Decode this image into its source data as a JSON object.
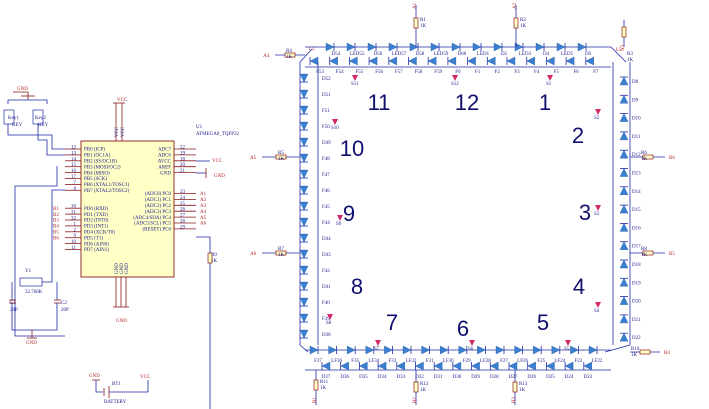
{
  "mcu": {
    "ref": "U1",
    "part": "ATMEGA8_TQFP32",
    "left_pins": [
      {
        "num": "12",
        "name": "PB0 (ICP)"
      },
      {
        "num": "13",
        "name": "PB1 (OC1A)"
      },
      {
        "num": "14",
        "name": "PB2 (SS/OC1B)"
      },
      {
        "num": "15",
        "name": "PB3 (MOSI/OC2)"
      },
      {
        "num": "16",
        "name": "PB4 (MISO)"
      },
      {
        "num": "17",
        "name": "PB5 (SCK)"
      },
      {
        "num": "7",
        "name": "PB6 (XTAL1/TOSC1)"
      },
      {
        "num": "8",
        "name": "PB7 (XTAL2/TOSC2)"
      },
      {
        "num": "30",
        "name": "PD0 (RXD)"
      },
      {
        "num": "31",
        "name": "PD1 (TXD)"
      },
      {
        "num": "32",
        "name": "PD2 (INT0)"
      },
      {
        "num": "1",
        "name": "PD3 (INT1)"
      },
      {
        "num": "2",
        "name": "PD4 (XCK/T0)"
      },
      {
        "num": "9",
        "name": "PD5 (T1)"
      },
      {
        "num": "10",
        "name": "PD6 (AIN0)"
      },
      {
        "num": "11",
        "name": "PD7 (AIN1)"
      }
    ],
    "right_pins": [
      {
        "num": "22",
        "name": "ADC7"
      },
      {
        "num": "19",
        "name": "ADC6"
      },
      {
        "num": "18",
        "name": "AVCC"
      },
      {
        "num": "20",
        "name": "AREF"
      },
      {
        "num": "21",
        "name": "GND"
      },
      {
        "num": "23",
        "name": "(ADC0) PC0"
      },
      {
        "num": "24",
        "name": "(ADC1) PC1"
      },
      {
        "num": "25",
        "name": "(ADC2) PC2"
      },
      {
        "num": "26",
        "name": "(ADC3) PC3"
      },
      {
        "num": "27",
        "name": "(ADC4/SDA) PC4"
      },
      {
        "num": "28",
        "name": "(ADC5/SCL) PC5"
      },
      {
        "num": "29",
        "name": "(RESET) PC6"
      }
    ],
    "top_pins": [
      "VCC",
      "VCC"
    ],
    "bottom_pins": [
      "GND",
      "GND",
      "GND"
    ],
    "left_net_labels": [
      "B1",
      "B2",
      "B3",
      "B4",
      "B5",
      "B6"
    ],
    "right_net_labels": [
      "A1",
      "A2",
      "A3",
      "A4",
      "A5",
      "A6"
    ]
  },
  "power": {
    "vcc": "VCC",
    "gnd": "GND"
  },
  "keys": [
    {
      "ref": "Key1",
      "label": "KEY"
    },
    {
      "ref": "Key2",
      "label": "KEY"
    }
  ],
  "crystal": {
    "ref": "Y1",
    "value": "32.768K"
  },
  "caps": [
    {
      "ref": "C1",
      "value": "20P"
    },
    {
      "ref": "C2",
      "value": "20P"
    }
  ],
  "battery": {
    "ref": "BT1",
    "label": "BATTERY"
  },
  "reset_resistor": {
    "ref": "R9",
    "value": "1K"
  },
  "resistors": [
    {
      "ref": "R1",
      "value": "1K",
      "net": "A1"
    },
    {
      "ref": "R2",
      "value": "1K",
      "net": "A2"
    },
    {
      "ref": "R3",
      "value": "1K",
      "net": "A3"
    },
    {
      "ref": "R4",
      "value": "1K",
      "net": "A4"
    },
    {
      "ref": "R5",
      "value": "1K",
      "net": "A5"
    },
    {
      "ref": "R6",
      "value": "1K",
      "net": "B6"
    },
    {
      "ref": "R7",
      "value": "1K",
      "net": "A6"
    },
    {
      "ref": "R8",
      "value": "1K",
      "net": "B5"
    },
    {
      "ref": "R10",
      "value": "1K",
      "net": "B4"
    },
    {
      "ref": "R11",
      "value": "1K",
      "net": "B1"
    },
    {
      "ref": "R12",
      "value": "1K",
      "net": "B2"
    },
    {
      "ref": "R13",
      "value": "1K",
      "net": "B3"
    }
  ],
  "clock_numbers": [
    "12",
    "1",
    "2",
    "3",
    "4",
    "5",
    "6",
    "7",
    "8",
    "9",
    "10",
    "11"
  ],
  "led_labels_top_upper": [
    "D54",
    "LED55",
    "D56",
    "LED57",
    "D58",
    "LED59",
    "D60",
    "LED1",
    "D2",
    "LED3",
    "D4",
    "LED5",
    "D6"
  ],
  "led_labels_top_lower": [
    "F53",
    "F54",
    "F55",
    "F56",
    "F57",
    "F58",
    "F59",
    "F0",
    "F1",
    "F2",
    "F3",
    "F4",
    "F5",
    "F6",
    "F7"
  ],
  "led_labels_bottom_upper": [
    "F37",
    "LF36",
    "F35",
    "LF34",
    "F33",
    "LF32",
    "F31",
    "LF30",
    "F29",
    "LF28",
    "F27",
    "LF26",
    "F25",
    "LF24",
    "F23",
    "LF22"
  ],
  "led_labels_bottom_lower": [
    "D37",
    "D36",
    "D35",
    "D34",
    "D33",
    "D32",
    "D31",
    "D30",
    "D29",
    "D28",
    "D27",
    "D26",
    "D25",
    "D24",
    "D23"
  ],
  "led_labels_left": [
    "D52",
    "D51",
    "F51",
    "F50",
    "D49",
    "F48",
    "F47",
    "F46",
    "F45",
    "F44",
    "D44",
    "D43",
    "F42",
    "D41",
    "F40",
    "F39",
    "D38"
  ],
  "led_labels_right": [
    "D8",
    "D9",
    "D10",
    "D11",
    "D12",
    "D13",
    "D14",
    "D15",
    "D16",
    "D17",
    "D18",
    "D19",
    "D20",
    "D21",
    "D22"
  ],
  "second_labels": [
    "S11",
    "S12",
    "S1",
    "S2",
    "S3",
    "S4",
    "S5",
    "S6",
    "S7",
    "S8",
    "S9",
    "S10"
  ],
  "l_labels": [
    "L2",
    "L5"
  ]
}
